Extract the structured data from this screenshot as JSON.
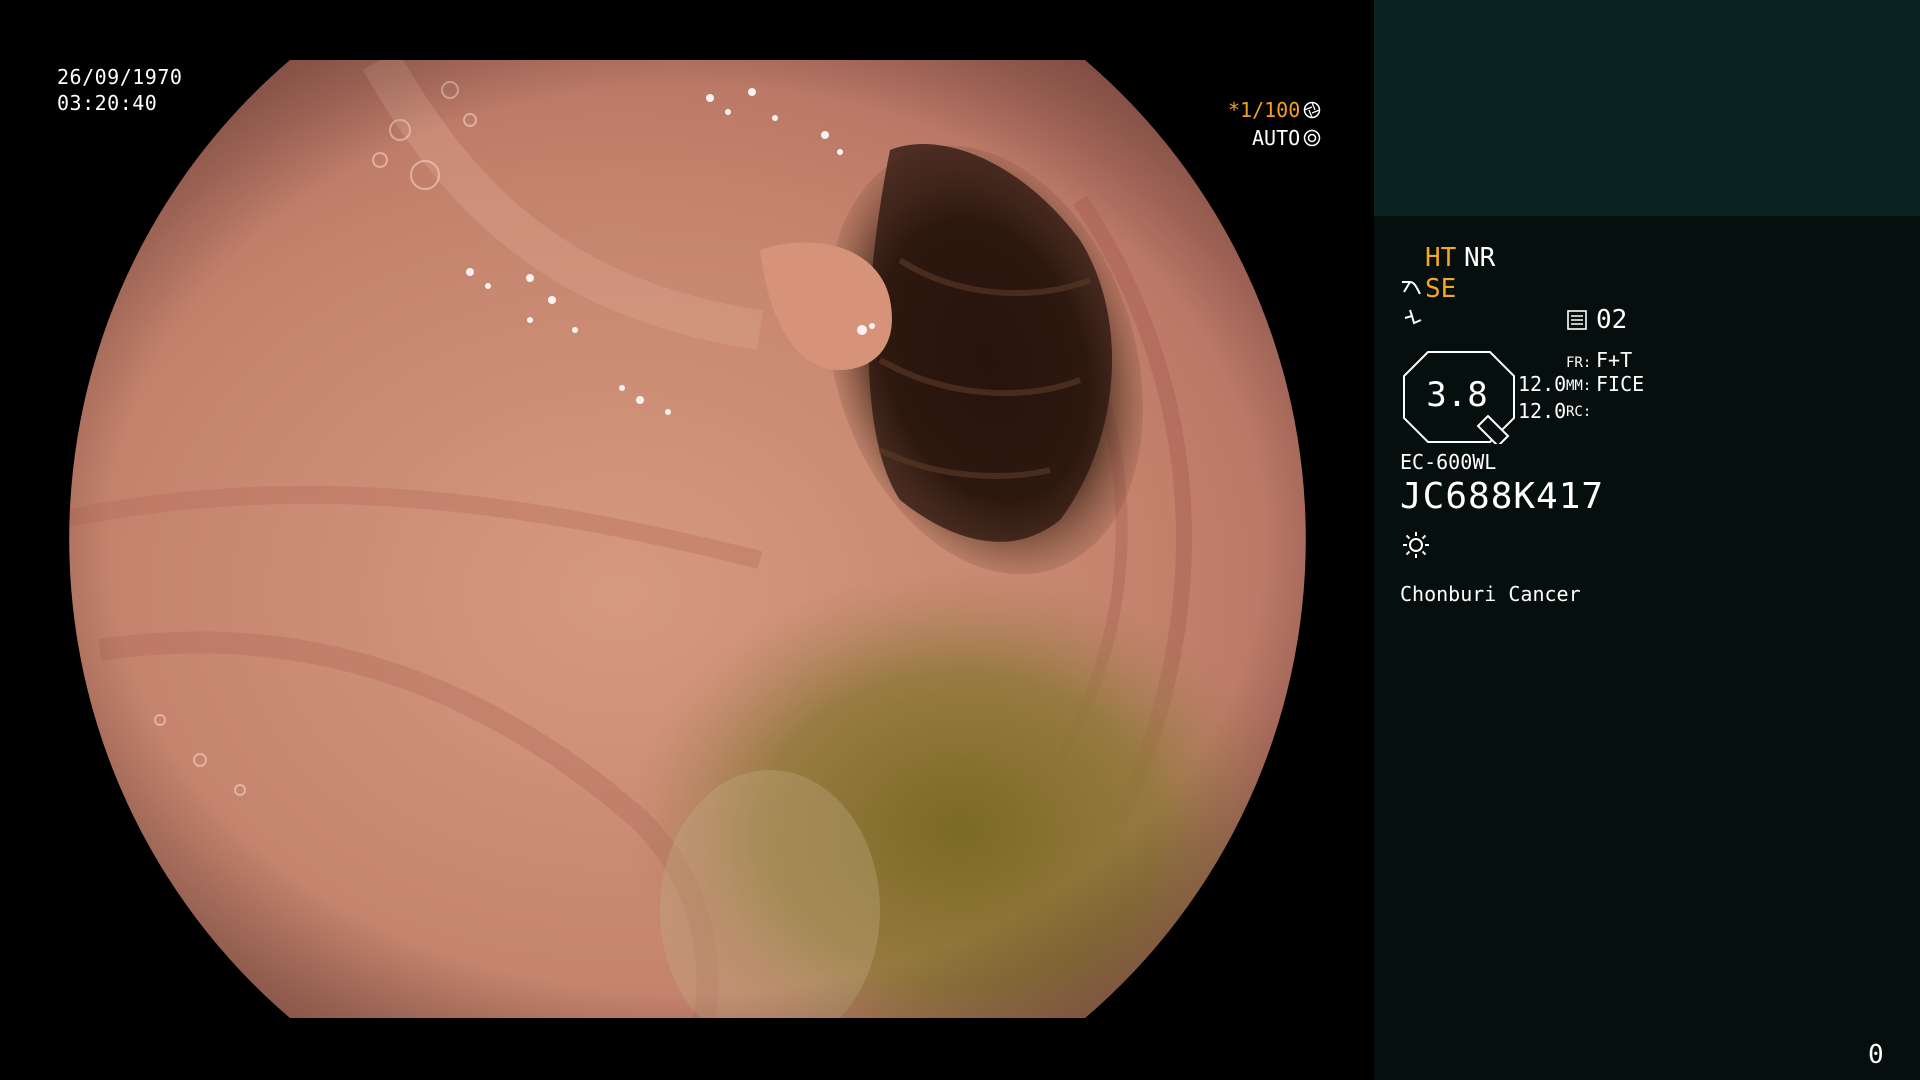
{
  "overlay": {
    "date": "26/09/1970",
    "time": "03:20:40",
    "shutter": "*1/100",
    "mode": "AUTO"
  },
  "panel": {
    "ht": "HT",
    "nr": "NR",
    "se": "SE",
    "channel": "02",
    "gauge_value": "3.8",
    "value_1": "12.0",
    "value_2": "12.0",
    "fr_label": "FR:",
    "fr_value": "F+T",
    "mm_label": "MM:",
    "mm_value": "FICE",
    "rc_label": "RC:",
    "scope_model": "EC-600WL",
    "serial": "JC688K417",
    "hospital": "Chonburi Cancer",
    "counter": "0"
  },
  "colors": {
    "accent_orange": "#f5a623",
    "panel_bg": "#040f0e",
    "panel_top_bg": "#0c2324"
  },
  "icons": [
    "shutter-icon",
    "auto-iris-icon",
    "scissors-icon",
    "flash-icon",
    "lines-icon",
    "lamp-icon"
  ]
}
